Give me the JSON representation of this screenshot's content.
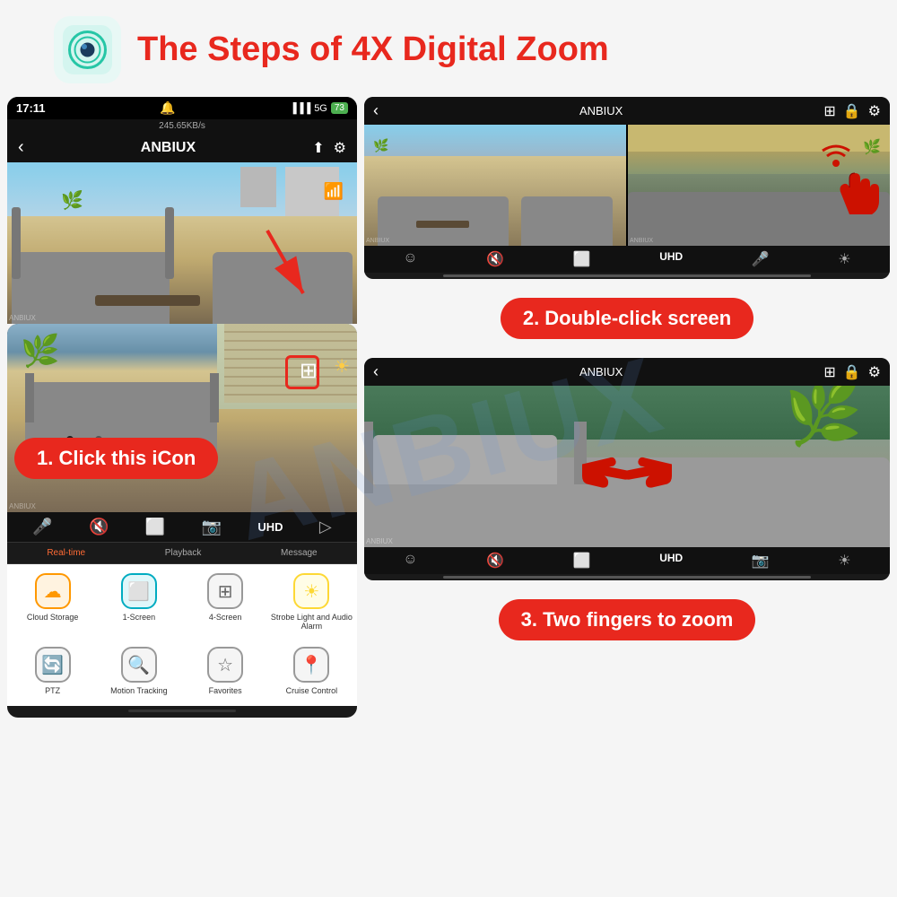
{
  "watermark": "ANBIUX",
  "header": {
    "title": "The Steps of 4X Digital Zoom"
  },
  "phone_top": {
    "time": "17:11",
    "signal": "5G",
    "battery": "73",
    "speed": "245.65KB/s",
    "title": "ANBIUX"
  },
  "step1": {
    "label": "1. Click this iCon"
  },
  "step2": {
    "label": "2. Double-click screen"
  },
  "step3": {
    "label": "3. Two fingers to zoom"
  },
  "icons": [
    {
      "label": "Cloud Storage",
      "style": "orange"
    },
    {
      "label": "1-Screen",
      "style": "teal"
    },
    {
      "label": "4-Screen",
      "style": "gray"
    },
    {
      "label": "Strobe Light and Audio Alarm",
      "style": "yellow"
    }
  ],
  "icons_row2": [
    {
      "label": "PTZ",
      "style": "gray"
    },
    {
      "label": "Motion Tracking",
      "style": "gray"
    },
    {
      "label": "Favorites",
      "style": "gray"
    },
    {
      "label": "Cruise Control",
      "style": "gray"
    }
  ],
  "tabs": [
    {
      "label": "Real-time",
      "active": true
    },
    {
      "label": "Playback",
      "active": false
    },
    {
      "label": "Message",
      "active": false
    }
  ],
  "dual_panel": {
    "title": "ANBIUX"
  },
  "zoom_panel": {
    "title": "ANBIUX"
  }
}
